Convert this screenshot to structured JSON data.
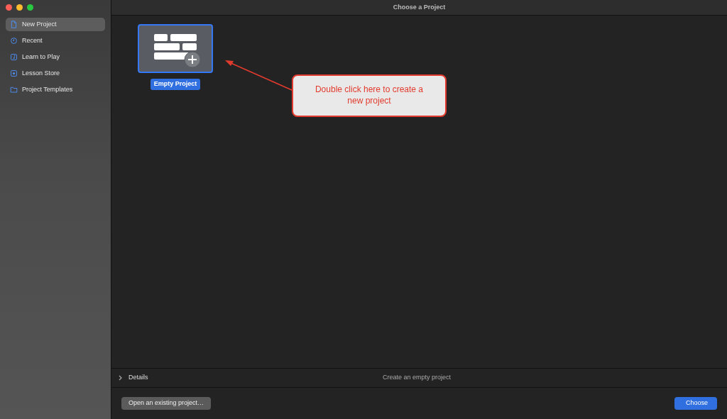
{
  "window": {
    "title": "Choose a Project"
  },
  "sidebar": {
    "items": [
      {
        "label": "New Project",
        "selected": true
      },
      {
        "label": "Recent",
        "selected": false
      },
      {
        "label": "Learn to Play",
        "selected": false
      },
      {
        "label": "Lesson Store",
        "selected": false
      },
      {
        "label": "Project Templates",
        "selected": false
      }
    ]
  },
  "templates": [
    {
      "label": "Empty Project",
      "selected": true
    }
  ],
  "annotation": {
    "text": "Double click here to create a new project"
  },
  "details": {
    "label": "Details",
    "expanded": false,
    "description": "Create an empty project"
  },
  "buttons": {
    "open": "Open an existing project…",
    "choose": "Choose"
  }
}
